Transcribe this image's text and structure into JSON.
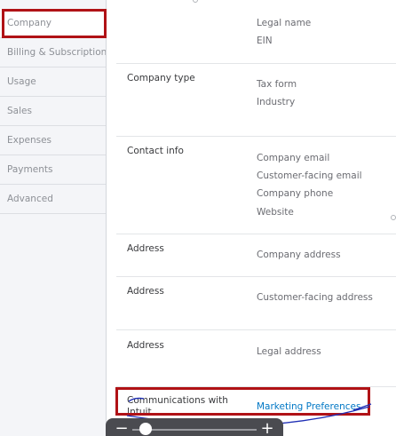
{
  "sidebar": {
    "items": [
      {
        "label": "Company"
      },
      {
        "label": "Billing & Subscription"
      },
      {
        "label": "Usage"
      },
      {
        "label": "Sales"
      },
      {
        "label": "Expenses"
      },
      {
        "label": "Payments"
      },
      {
        "label": "Advanced"
      }
    ]
  },
  "company_name": {
    "fields": [
      "Legal name",
      "EIN"
    ]
  },
  "company_type": {
    "label": "Company type",
    "fields": [
      "Tax form",
      "Industry"
    ]
  },
  "contact_info": {
    "label": "Contact info",
    "fields": [
      "Company email",
      "Customer-facing email",
      "Company phone",
      "Website"
    ]
  },
  "address_company": {
    "label": "Address",
    "field": "Company address"
  },
  "address_customer": {
    "label": "Address",
    "field": "Customer-facing address"
  },
  "address_legal": {
    "label": "Address",
    "field": "Legal address"
  },
  "communications": {
    "label": "Communications with Intuit",
    "link": "Marketing Preferences"
  },
  "zoom": {
    "minus": "−",
    "plus": "+"
  },
  "colors": {
    "highlight": "#b01216",
    "link": "#0077c5",
    "scribble": "#1f2fb5"
  }
}
